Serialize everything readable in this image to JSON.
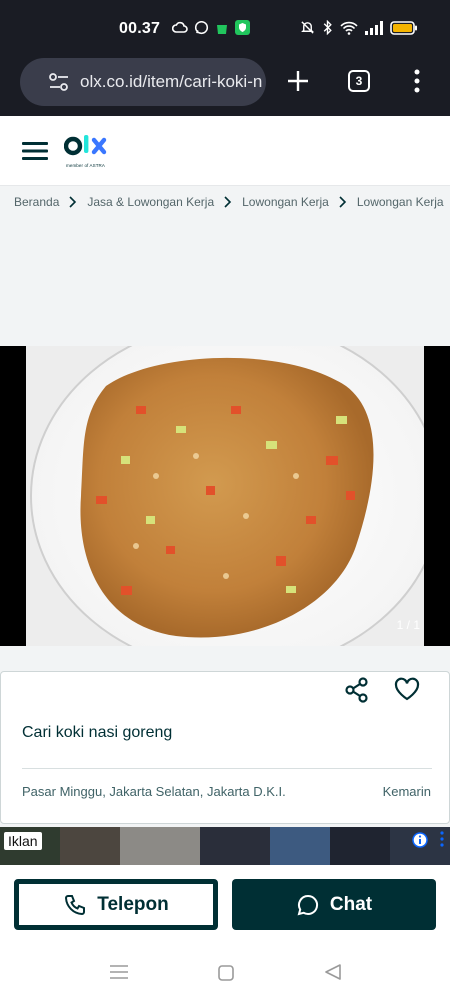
{
  "status": {
    "time": "00.37",
    "icons_left": [
      "cloud-sync-icon",
      "whatsapp-icon",
      "shopee-icon",
      "shield-app-icon"
    ],
    "icons_right": [
      "mute-icon",
      "bluetooth-icon",
      "wifi-icon",
      "signal-icon",
      "battery-icon"
    ],
    "battery_color": "#f5b400"
  },
  "browser": {
    "url": "olx.co.id/item/cari-koki-n",
    "tab_count": "3"
  },
  "header": {
    "logo_text": "olx",
    "logo_sub": "member of ASTRA",
    "brand_color": "#002f34",
    "accent_color": "#23e5db"
  },
  "breadcrumb": [
    "Beranda",
    "Jasa & Lowongan Kerja",
    "Lowongan Kerja",
    "Lowongan Kerja"
  ],
  "gallery": {
    "counter": "1 / 1",
    "photo_subject": "nasi goreng"
  },
  "listing": {
    "title": "Cari koki nasi goreng",
    "location": "Pasar Minggu, Jakarta Selatan, Jakarta D.K.I.",
    "date": "Kemarin"
  },
  "ad": {
    "label": "Iklan"
  },
  "actions": {
    "telepon_label": "Telepon",
    "chat_label": "Chat"
  }
}
